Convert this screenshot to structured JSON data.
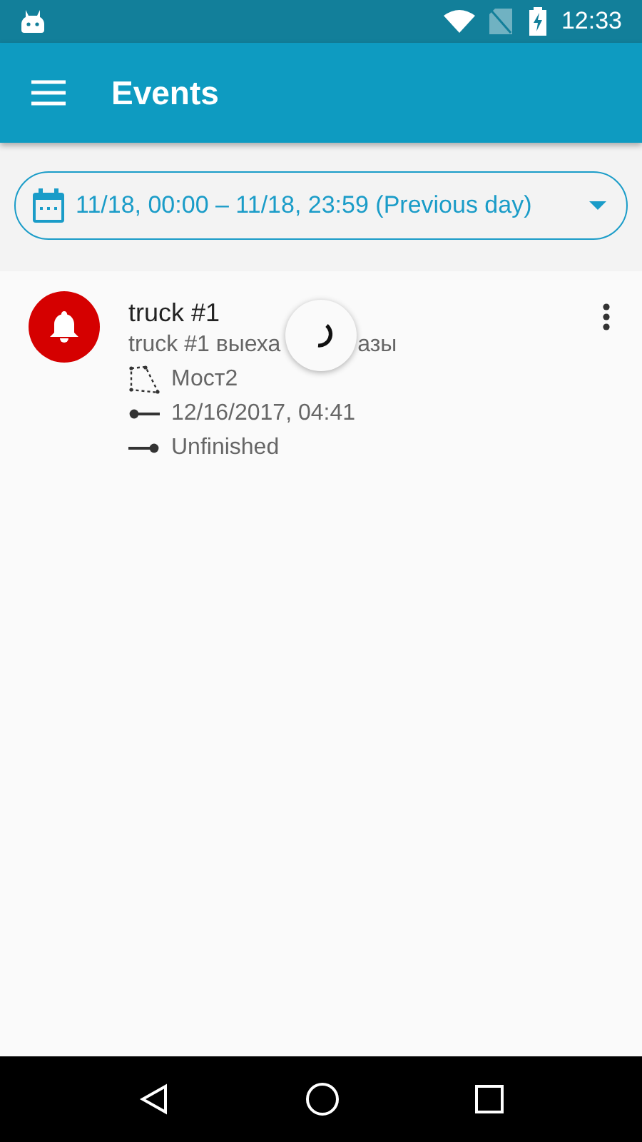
{
  "status_bar": {
    "time": "12:33"
  },
  "app_bar": {
    "title": "Events"
  },
  "filter": {
    "label": "11/18, 00:00 – 11/18, 23:59 (Previous day)"
  },
  "loading": true,
  "events": [
    {
      "title": "truck #1",
      "subtitle_parts": [
        "truck #1 выеха",
        "азы"
      ],
      "geofence": "Мост2",
      "start": "12/16/2017, 04:41",
      "end": "Unfinished",
      "color": "#d50000"
    }
  ]
}
